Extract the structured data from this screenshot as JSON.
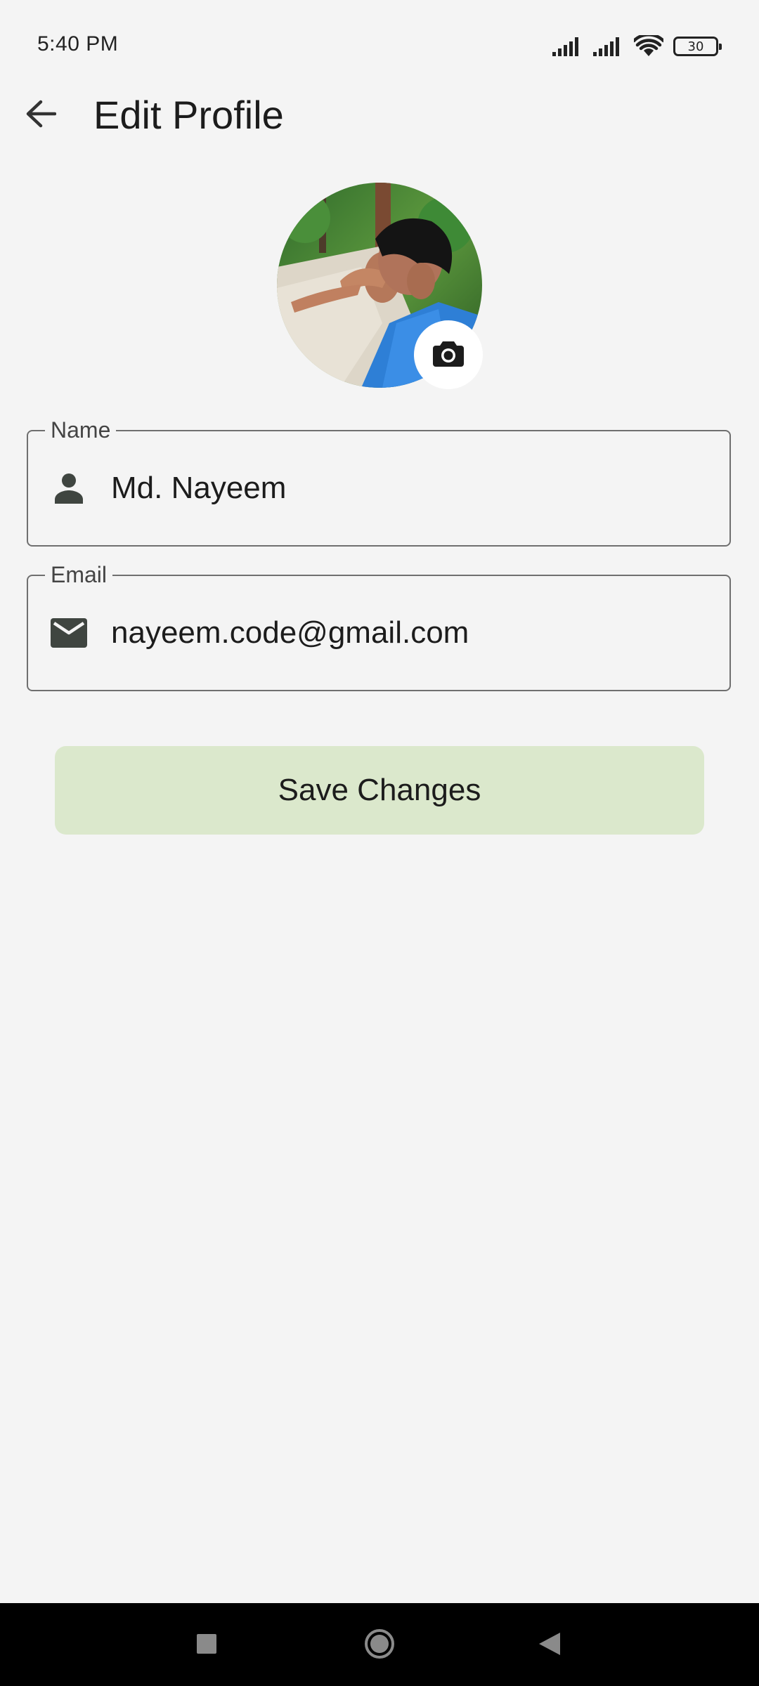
{
  "status_bar": {
    "time": "5:40 PM",
    "battery_level": "30",
    "icons": [
      "cell-signal-icon",
      "cell-signal-icon",
      "wifi-icon",
      "battery-icon"
    ]
  },
  "app_bar": {
    "title": "Edit Profile",
    "back_icon": "arrow-back-icon"
  },
  "avatar": {
    "camera_icon": "camera-icon"
  },
  "form": {
    "name": {
      "label": "Name",
      "value": "Md. Nayeem",
      "icon": "person-icon"
    },
    "email": {
      "label": "Email",
      "value": "nayeem.code@gmail.com",
      "icon": "mail-icon"
    }
  },
  "save_button": {
    "label": "Save Changes"
  },
  "colors": {
    "background": "#f4f4f4",
    "save_button_bg": "#dbe8cc",
    "field_border": "#6f6f6f",
    "nav_bar": "#000000"
  },
  "nav_bar": {
    "buttons": [
      "recents-icon",
      "home-icon",
      "back-triangle-icon"
    ]
  }
}
